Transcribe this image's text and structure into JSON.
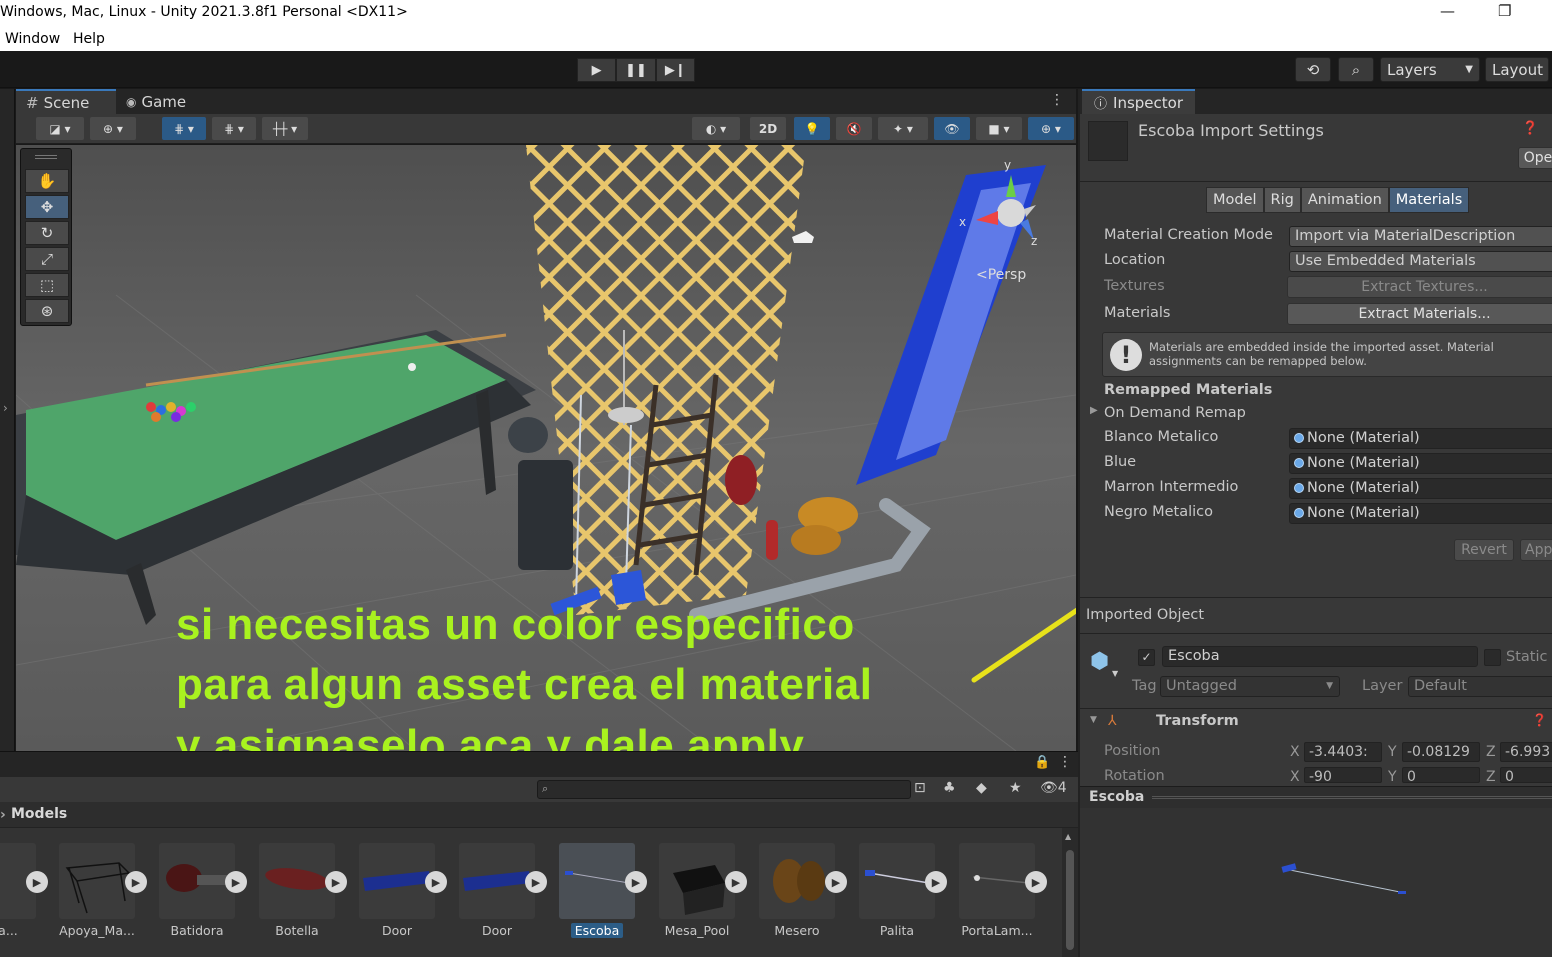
{
  "window": {
    "title": "Windows, Mac, Linux - Unity 2021.3.8f1 Personal <DX11>"
  },
  "menu": {
    "items": [
      "Window",
      "Help"
    ]
  },
  "toolbar": {
    "layers_label": "Layers",
    "layout_label": "Layout"
  },
  "scene": {
    "tabs": [
      {
        "label": "Scene",
        "icon": "grid-icon"
      },
      {
        "label": "Game",
        "icon": "gamepad-icon"
      }
    ],
    "btn_2d": "2D",
    "gizmo": {
      "x": "x",
      "y": "y",
      "z": "z",
      "persp": "<Persp"
    },
    "overlay": [
      "si necesitas un color especifico",
      "para algun asset crea el material",
      "y asignaselo aca y dale apply"
    ]
  },
  "project": {
    "breadcrumb": "Models",
    "hidden_count": "4",
    "assets": [
      {
        "name": "_Bra..."
      },
      {
        "name": "Apoya_Ma..."
      },
      {
        "name": "Batidora"
      },
      {
        "name": "Botella"
      },
      {
        "name": "Door"
      },
      {
        "name": "Door"
      },
      {
        "name": "Escoba",
        "selected": true
      },
      {
        "name": "Mesa_Pool"
      },
      {
        "name": "Mesero"
      },
      {
        "name": "Palita"
      },
      {
        "name": "PortaLam..."
      }
    ]
  },
  "inspector": {
    "tab_label": "Inspector",
    "title": "Escoba Import Settings",
    "open_label": "Ope",
    "tabs": [
      "Model",
      "Rig",
      "Animation",
      "Materials"
    ],
    "active_tab": "Materials",
    "material_creation_mode_label": "Material Creation Mode",
    "material_creation_mode_value": "Import via MaterialDescription",
    "location_label": "Location",
    "location_value": "Use Embedded Materials",
    "textures_label": "Textures",
    "extract_textures": "Extract Textures...",
    "materials_label": "Materials",
    "extract_materials": "Extract Materials...",
    "help_text": "Materials are embedded inside the imported asset. Material assignments can be remapped below.",
    "remapped_header": "Remapped Materials",
    "on_demand_remap": "On Demand Remap",
    "remaps": [
      {
        "label": "Blanco Metalico",
        "value": "None (Material)"
      },
      {
        "label": "Blue",
        "value": "None (Material)"
      },
      {
        "label": "Marron Intermedio",
        "value": "None (Material)"
      },
      {
        "label": "Negro Metalico",
        "value": "None (Material)"
      }
    ],
    "revert": "Revert",
    "apply": "App",
    "imported_object": "Imported Object",
    "object_name": "Escoba",
    "static_label": "Static",
    "tag_label": "Tag",
    "tag_value": "Untagged",
    "layer_label": "Layer",
    "layer_value": "Default",
    "transform_label": "Transform",
    "position_label": "Position",
    "position": {
      "x": "-3.4403:",
      "y": "-0.08129",
      "z": "-6.993"
    },
    "rotation_label": "Rotation",
    "rotation": {
      "x": "-90",
      "y": "0",
      "z": "0"
    },
    "preview_title": "Escoba"
  }
}
